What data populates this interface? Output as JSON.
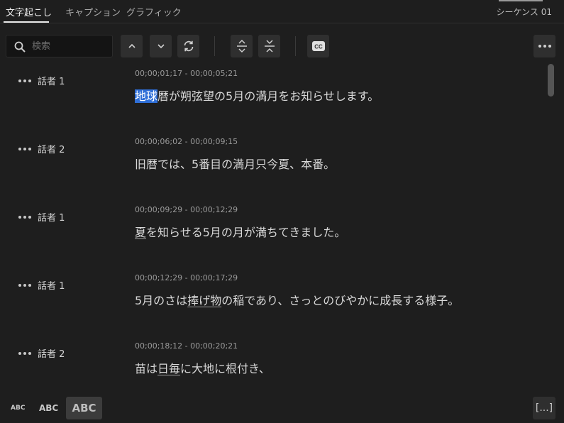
{
  "tabs": {
    "transcript": "文字起こし",
    "captions": "キャプション",
    "graphics": "グラフィック",
    "sequence": "シーケンス 01"
  },
  "search": {
    "placeholder": "検索",
    "value": ""
  },
  "toolbar_icons": [
    "search-icon",
    "chevron-up-icon",
    "chevron-down-icon",
    "refresh-icon",
    "expand-icon",
    "collapse-icon",
    "cc-icon",
    "more-icon"
  ],
  "rows": [
    {
      "speaker": "話者 1",
      "time": "00;00;01;17 - 00;00;05;21",
      "text_highlight": "地球",
      "text_rest": "暦が朔弦望の5月の満月をお知らせします。"
    },
    {
      "speaker": "話者 2",
      "time": "00;00;06;02 - 00;00;09;15",
      "text": "旧暦では、5番目の満月只今夏、本番。"
    },
    {
      "speaker": "話者 1",
      "time": "00;00;09;29 - 00;00;12;29",
      "text_underline": "夏",
      "text_rest": "を知らせる5月の月が満ちてきました。"
    },
    {
      "speaker": "話者 1",
      "time": "00;00;12;29 - 00;00;17;29",
      "text_pre": "5月のさは",
      "text_underline": "捧げ物",
      "text_rest": "の稲であり、さっとのびやかに成長する様子。"
    },
    {
      "speaker": "話者 2",
      "time": "00;00;18;12 - 00;00;20;21",
      "text_pre": "苗は",
      "text_underline": "日毎",
      "text_rest": "に大地に根付き、"
    }
  ],
  "bottom": {
    "abc_small": "ABC",
    "abc_medium": "ABC",
    "abc_large": "ABC",
    "bracket": "[...]"
  },
  "colors": {
    "background": "#1e1e1e",
    "highlight": "#2f6fd8",
    "button": "#2f2f2f"
  }
}
